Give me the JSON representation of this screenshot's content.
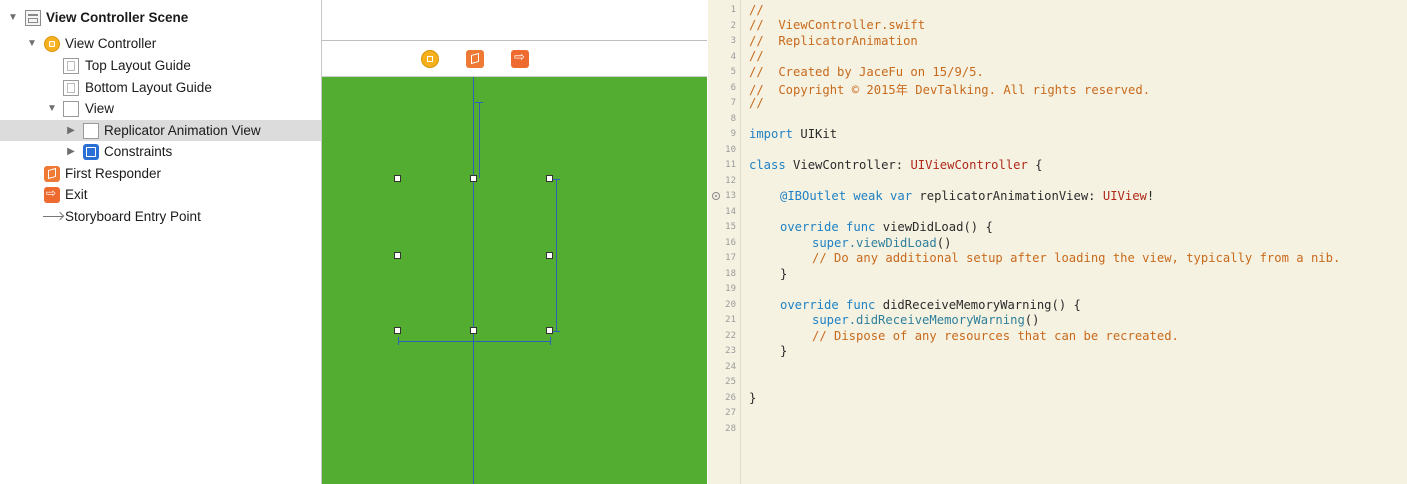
{
  "outline": {
    "scene_title": "View Controller Scene",
    "view_controller": "View Controller",
    "top_layout_guide": "Top Layout Guide",
    "bottom_layout_guide": "Bottom Layout Guide",
    "view": "View",
    "replicator_view": "Replicator Animation View",
    "constraints": "Constraints",
    "first_responder": "First Responder",
    "exit": "Exit",
    "entry_point": "Storyboard Entry Point"
  },
  "canvas": {
    "background_color": "#52ad31",
    "dock_icons": [
      "view-controller-icon",
      "first-responder-icon",
      "exit-icon"
    ]
  },
  "editor": {
    "line_numbers": [
      "1",
      "2",
      "3",
      "4",
      "5",
      "6",
      "7",
      "8",
      "9",
      "10",
      "11",
      "12",
      "13",
      "14",
      "15",
      "16",
      "17",
      "18",
      "19",
      "20",
      "21",
      "22",
      "23",
      "24",
      "25",
      "26",
      "27",
      "28"
    ],
    "l1": "//",
    "l2": "//  ViewController.swift",
    "l3": "//  ReplicatorAnimation",
    "l4": "//",
    "l5": "//  Created by JaceFu on 15/9/5.",
    "l6": "//  Copyright © 2015年 DevTalking. All rights reserved.",
    "l7": "//",
    "l9_kw": "import",
    "l9_rest": " UIKit",
    "l11_kw": "class",
    "l11_mid": " ViewController: ",
    "l11_ty": "UIViewController",
    "l11_end": " {",
    "l13_kw": "@IBOutlet weak var",
    "l13_mid": " replicatorAnimationView: ",
    "l13_ty": "UIView",
    "l13_end": "!",
    "l15_kw": "override func",
    "l15_rest": " viewDidLoad() {",
    "l16_kw": "super",
    "l16_fn": ".viewDidLoad",
    "l16_end": "()",
    "l17": "// Do any additional setup after loading the view, typically from a nib.",
    "l18": "}",
    "l20_kw": "override func",
    "l20_rest": " didReceiveMemoryWarning() {",
    "l21_kw": "super",
    "l21_fn": ".didReceiveMemoryWarning",
    "l21_end": "()",
    "l22": "// Dispose of any resources that can be recreated.",
    "l23": "}",
    "l26": "}"
  }
}
